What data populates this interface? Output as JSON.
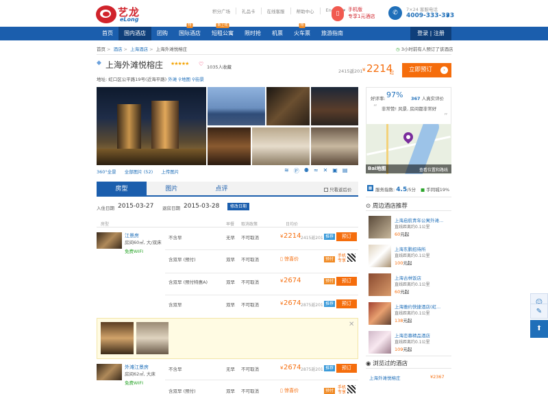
{
  "brand": {
    "name": "艺龙",
    "sub": "eLong"
  },
  "toplinks": [
    "积分广场",
    "礼品卡",
    "在线客服",
    "帮助中心",
    "English ▾"
  ],
  "mobile": {
    "line1": "手机版",
    "line2": "专享1元酒店"
  },
  "tel": {
    "label": "7×24 客服电话",
    "number": "4009-333-333"
  },
  "nav": {
    "items": [
      {
        "label": "首页",
        "badge": ""
      },
      {
        "label": "国内酒店",
        "badge": ""
      },
      {
        "label": "团购",
        "badge": ""
      },
      {
        "label": "国际酒店",
        "badge": "特"
      },
      {
        "label": "短租公寓",
        "badge": "新上线"
      },
      {
        "label": "限时抢",
        "badge": ""
      },
      {
        "label": "机票",
        "badge": ""
      },
      {
        "label": "火车票",
        "badge": "特"
      },
      {
        "label": "旅游指南",
        "badge": ""
      }
    ],
    "login": "登录 | 注册"
  },
  "breadcrumb": [
    "首页",
    "酒店",
    "上海酒店",
    "上海外滩悦榕庄"
  ],
  "booked_notice": "3小时前有人预订了该酒店",
  "hotel": {
    "name": "上海外滩悦榕庄",
    "stars": "★★★★★",
    "favorites": "1035人收藏",
    "address_label": "地址:",
    "address": "虹口区公平路19号(近海平路)",
    "area": "外滩",
    "map_link": "地图",
    "street_link": "街景",
    "price_orig": "2415返201",
    "price_currency": "¥",
    "price": "2214",
    "price_suffix": "起",
    "book_label": "立即预订"
  },
  "photo_bar": {
    "view360": "360°全景",
    "all_photos": "全部图片 (52)",
    "upload": "上传图片"
  },
  "facility_icons": [
    "wifi-icon",
    "parking-icon",
    "gym-icon",
    "pool-icon",
    "restaurant-icon",
    "bus-icon",
    "luggage-icon"
  ],
  "rating": {
    "label": "好评率:",
    "percent": "97%",
    "count": "367",
    "count_suffix": " 人真实评价",
    "review": "非常赞! 风景, 房间都非常好",
    "map_link": "查看位置和路线",
    "map_brand": "Bai地图"
  },
  "service": {
    "label": "服务指数:",
    "score": "4.5",
    "max": "/5分",
    "tag": "手同城19%"
  },
  "tabs": [
    "房型",
    "图片",
    "点评"
  ],
  "only_rebate": "只看返后价",
  "dates": {
    "checkin_label": "入住日期",
    "checkin": "2015-03-27",
    "checkout_label": "退房日期",
    "checkout": "2015-03-28",
    "modify": "修改日期"
  },
  "table_headers": [
    "房型",
    "早餐",
    "取消政策",
    "日均价"
  ],
  "rooms": [
    {
      "name": "江景房",
      "spec1": "房间60㎡, 大/双床",
      "wifi": "免费WIFI",
      "plans": [
        {
          "name": "不含早",
          "breakfast": "无早",
          "cancel": "不可取消",
          "price": "2214",
          "orig": "2415返201",
          "tag": "推荐",
          "action": "预订",
          "kind": "price"
        },
        {
          "name": "含双早 (预付)",
          "breakfast": "双早",
          "cancel": "不可取消",
          "surprise": "惊喜价",
          "tag": "预付",
          "mobile": "手机专享",
          "kind": "mobile"
        },
        {
          "name": "含双早 (预付特惠A)",
          "breakfast": "双早",
          "cancel": "不可取消",
          "price": "2674",
          "tag": "预付",
          "action": "预订",
          "kind": "price"
        },
        {
          "name": "含双早",
          "breakfast": "双早",
          "cancel": "不可取消",
          "price": "2674",
          "orig": "2875返201",
          "tag": "推荐",
          "action": "预订",
          "kind": "price"
        }
      ]
    },
    {
      "name": "外滩江景房",
      "spec1": "房间62㎡, 大床",
      "wifi": "免费WIFI",
      "plans": [
        {
          "name": "不含早",
          "breakfast": "无早",
          "cancel": "不可取消",
          "price": "2674",
          "orig": "2875返201",
          "tag": "推荐",
          "action": "预订",
          "kind": "price"
        },
        {
          "name": "含双早 (预付)",
          "breakfast": "双早",
          "cancel": "不可取消",
          "surprise": "惊喜价",
          "tag": "预付",
          "mobile": "手机专享",
          "kind": "mobile"
        }
      ]
    }
  ],
  "nearby": {
    "title": "周边酒店推荐",
    "items": [
      {
        "name": "上海启航青年公寓外滩...",
        "dist": "直线距离约0.1公里",
        "price": "60",
        "suffix": "元起"
      },
      {
        "name": "上海东鹏招待所",
        "dist": "直线距离约0.1公里",
        "price": "100",
        "suffix": "元起"
      },
      {
        "name": "上海古林饭店",
        "dist": "直线距离约0.1公里",
        "price": "60",
        "suffix": "元起"
      },
      {
        "name": "上海雅约快捷酒店(虹...",
        "dist": "直线距离约0.1公里",
        "price": "138",
        "suffix": "元起"
      },
      {
        "name": "上海恋慕精品酒店",
        "dist": "直线距离约0.1公里",
        "price": "109",
        "suffix": "元起"
      }
    ]
  },
  "browsed": {
    "title": "浏览过的酒店",
    "name": "上海外滩悦榕庄",
    "price": "¥2367"
  },
  "colors": {
    "brand_red": "#d0232b",
    "nav_blue": "#1b5ead",
    "price_orange": "#f56d0c"
  }
}
